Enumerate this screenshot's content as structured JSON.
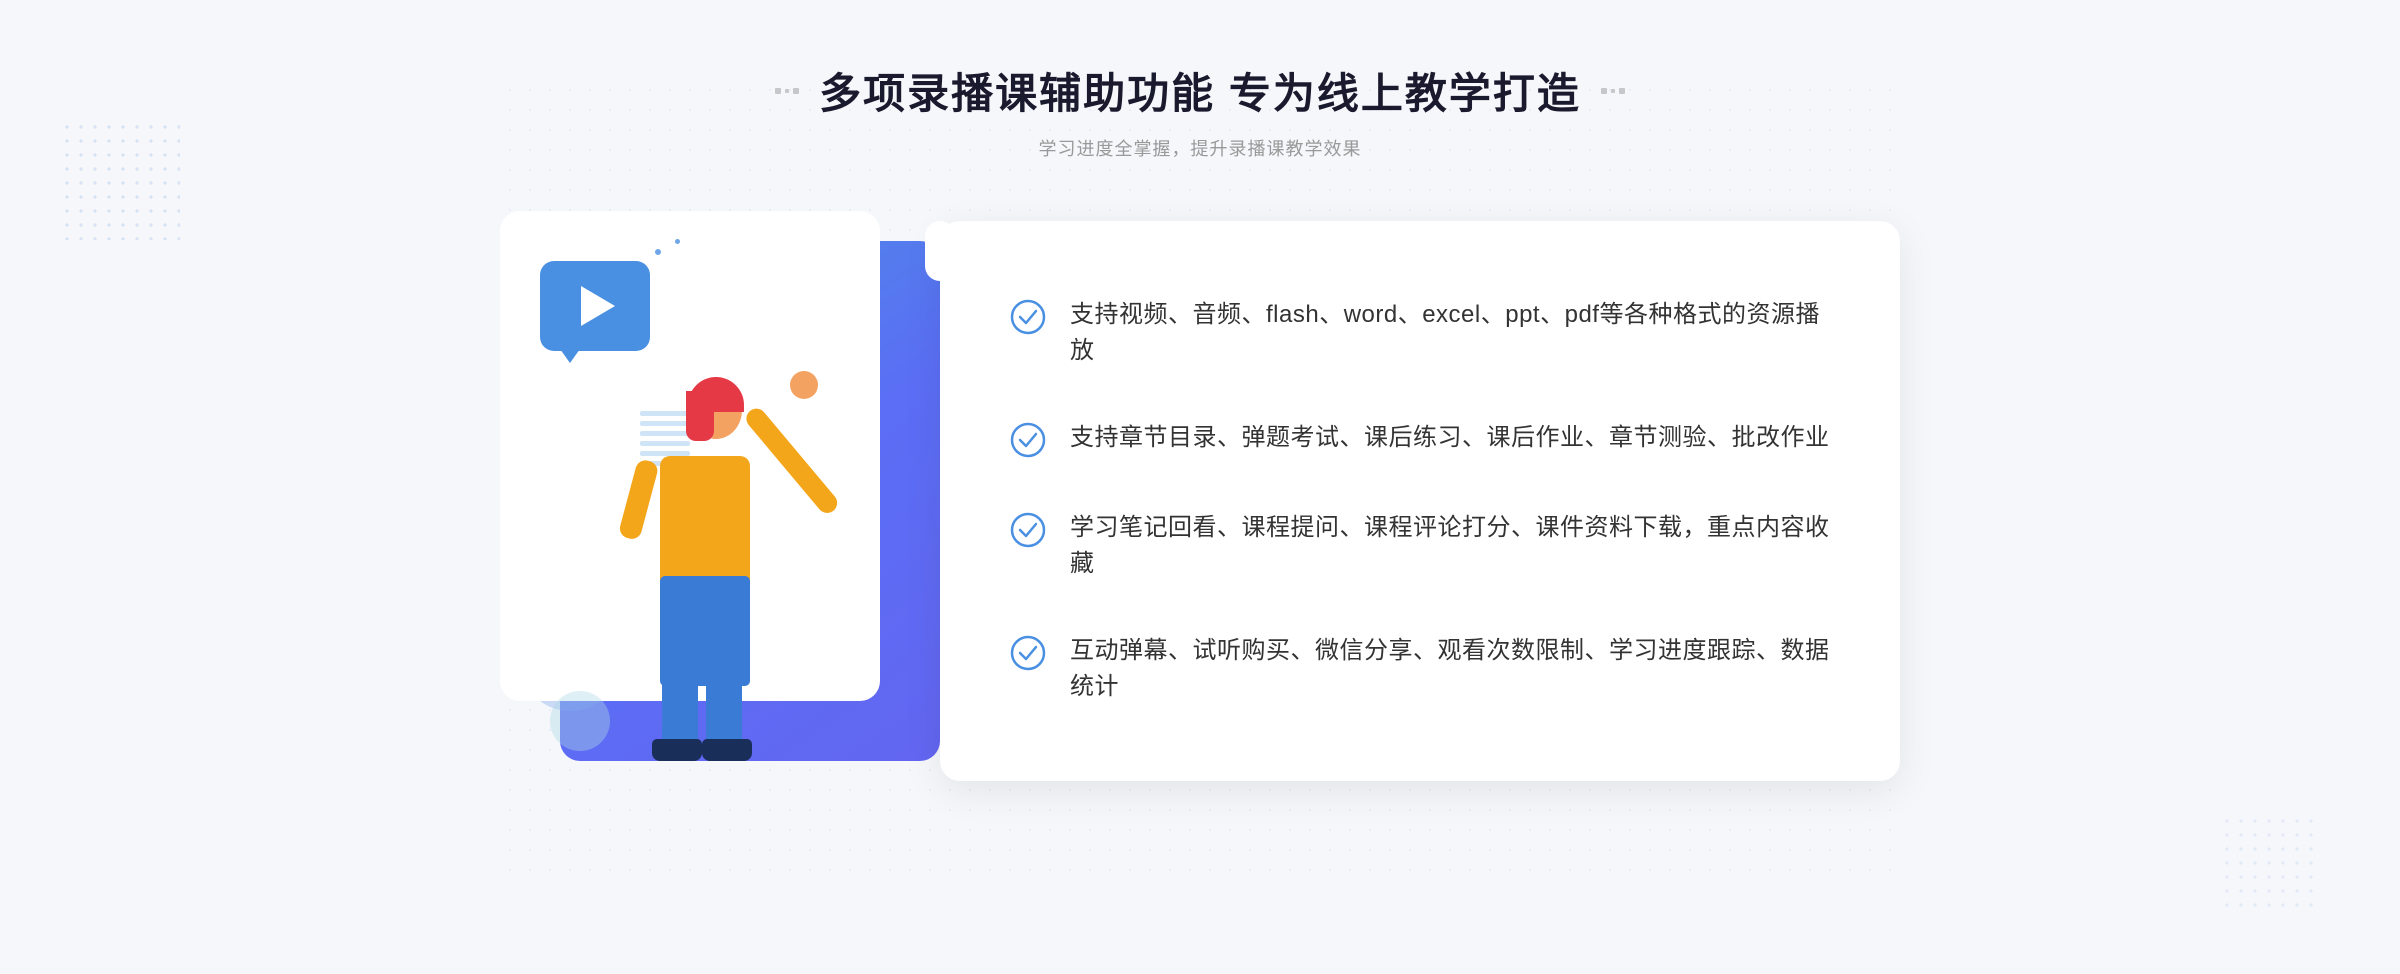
{
  "page": {
    "background_color": "#f5f7fa"
  },
  "header": {
    "title": "多项录播课辅助功能 专为线上教学打造",
    "subtitle": "学习进度全掌握，提升录播课教学效果",
    "decorator_left": "decorators",
    "decorator_right": "decorators"
  },
  "features": [
    {
      "id": 1,
      "text": "支持视频、音频、flash、word、excel、ppt、pdf等各种格式的资源播放"
    },
    {
      "id": 2,
      "text": "支持章节目录、弹题考试、课后练习、课后作业、章节测验、批改作业"
    },
    {
      "id": 3,
      "text": "学习笔记回看、课程提问、课程评论打分、课件资料下载，重点内容收藏"
    },
    {
      "id": 4,
      "text": "互动弹幕、试听购买、微信分享、观看次数限制、学习进度跟踪、数据统计"
    }
  ],
  "check_icon_color": "#4a90e2",
  "illustration": {
    "alt": "online teaching illustration"
  }
}
